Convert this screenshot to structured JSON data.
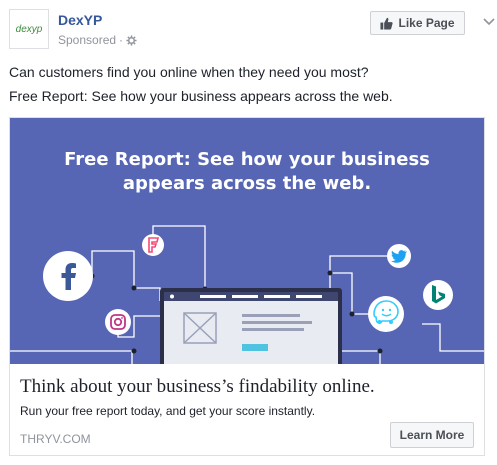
{
  "post": {
    "logo_text": "dexyp",
    "page_name": "DexYP",
    "sponsored_label": "Sponsored",
    "sponsored_separator": "·",
    "like_button": "Like Page",
    "message_line1": "Can customers find you online when they need you most?",
    "message_line2": "Free Report: See how your business appears across the web."
  },
  "banner": {
    "title_line1": "Free Report: See how your business",
    "title_line2": "appears across the web.",
    "background": "#5666b4",
    "icons": [
      "facebook-icon",
      "foursquare-icon",
      "instagram-icon",
      "twitter-icon",
      "waze-icon",
      "bing-icon",
      "browser-window-icon"
    ]
  },
  "card": {
    "headline": "Think about your business’s findability online.",
    "description": "Run your free report today, and get your score instantly.",
    "domain": "THRYV.COM",
    "cta_button": "Learn More"
  },
  "colors": {
    "link": "#365899",
    "muted": "#90949c",
    "facebook": "#3b5998",
    "twitter": "#1da1f2",
    "bing": "#008373",
    "foursquare": "#f94877",
    "instagram": "#c13584"
  }
}
